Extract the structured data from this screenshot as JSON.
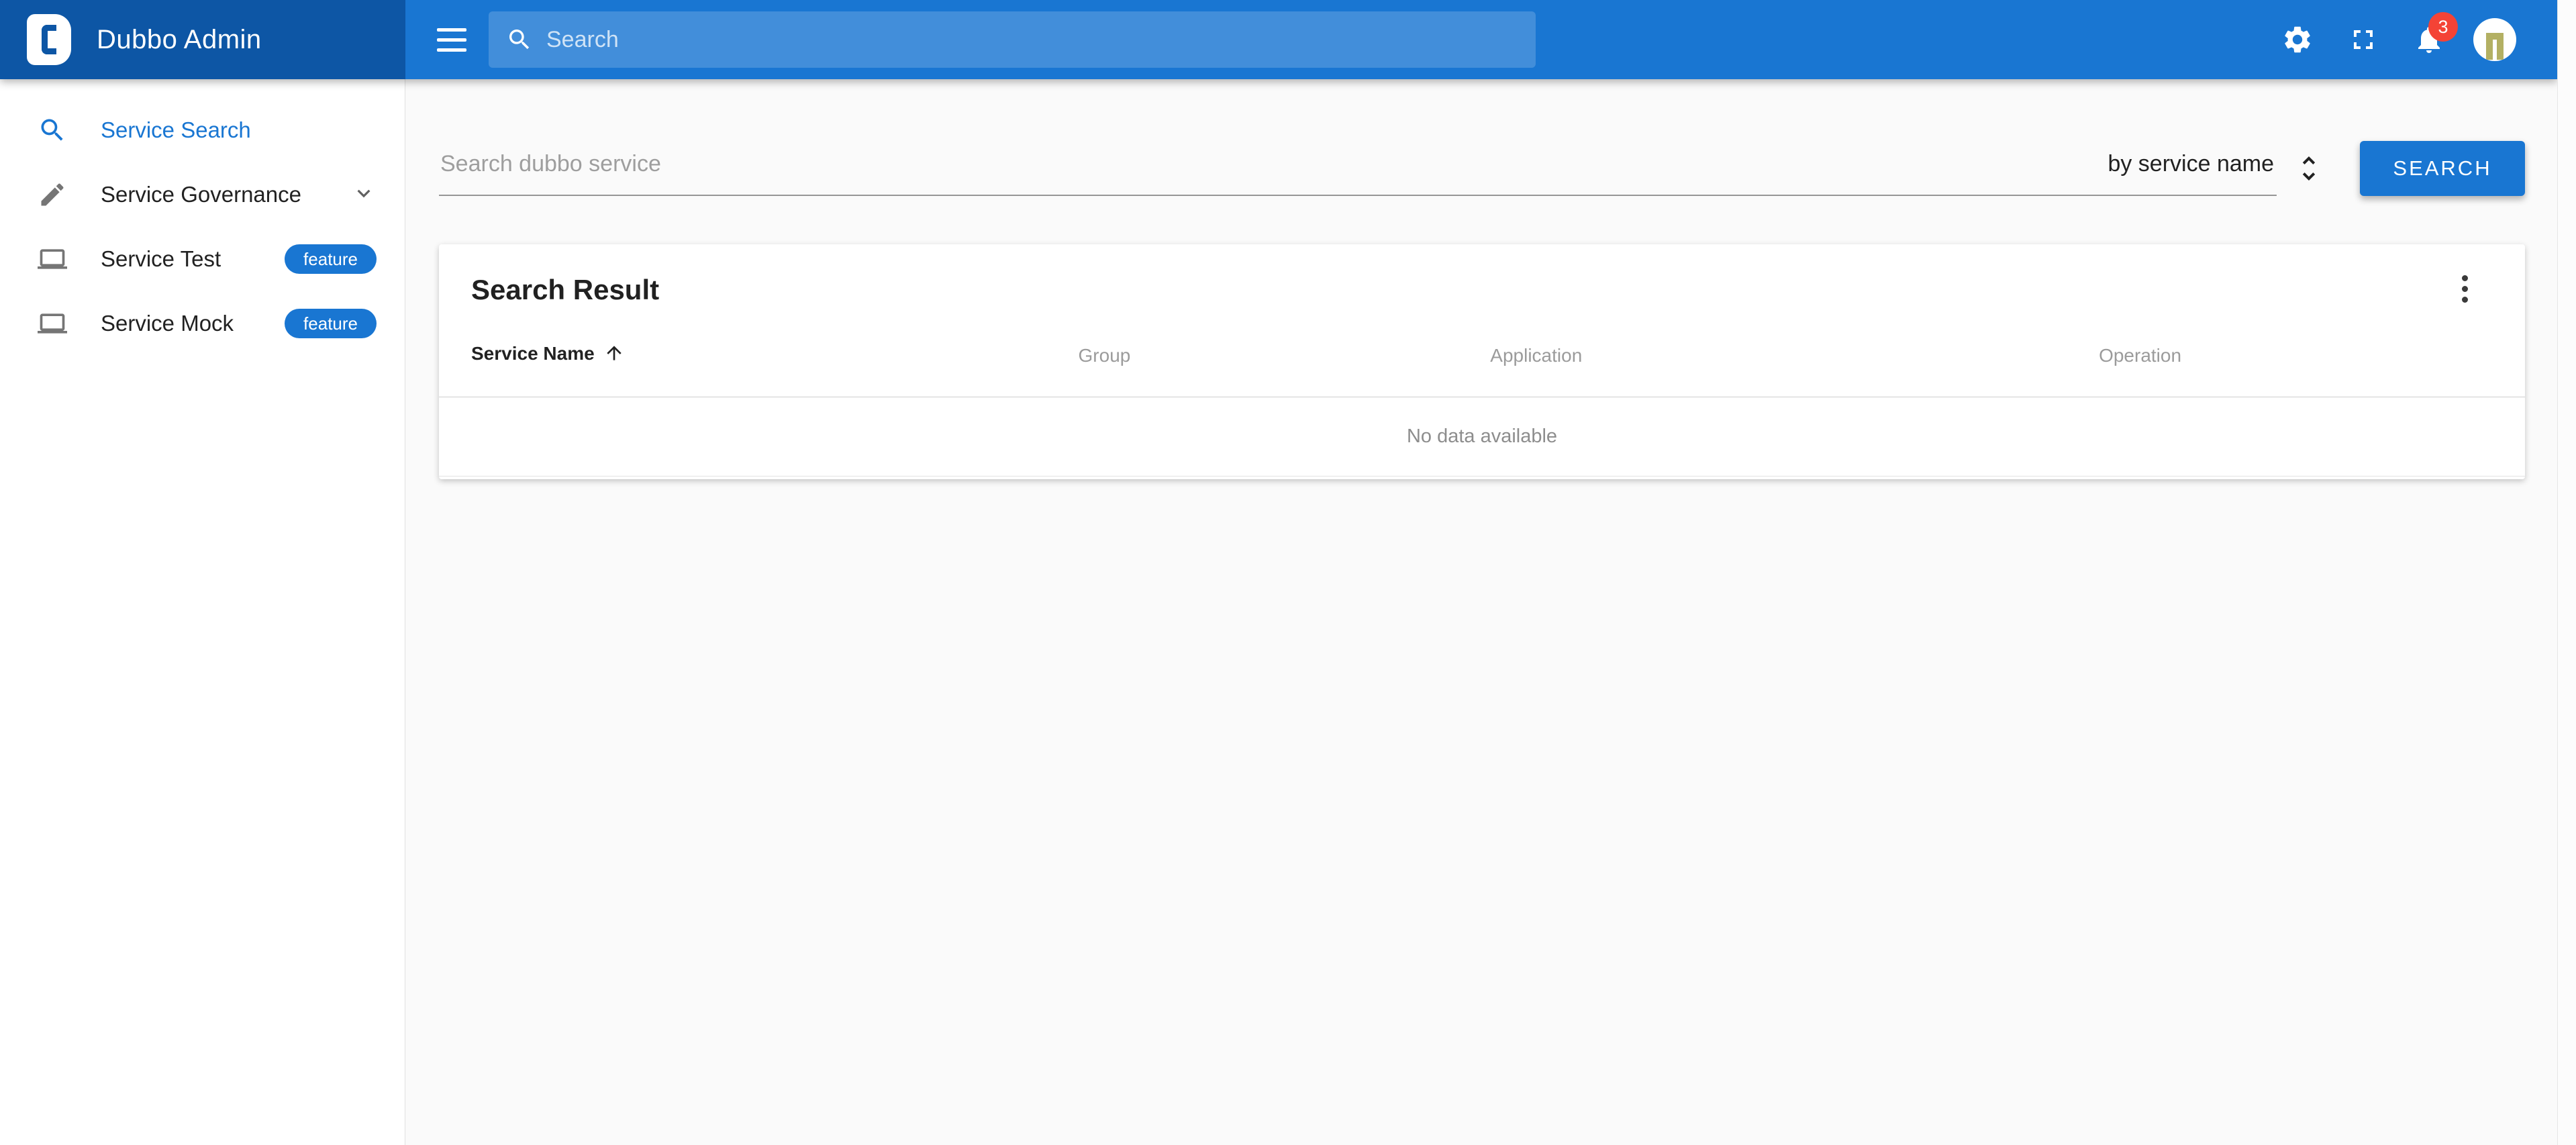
{
  "app_bar": {
    "title": "Dubbo Admin",
    "search": {
      "placeholder": "Search"
    },
    "notifications": {
      "badge_count": "3"
    }
  },
  "sidebar": {
    "items": [
      {
        "label": "Service Search"
      },
      {
        "label": "Service Governance"
      },
      {
        "label": "Service Test",
        "badge": "feature"
      },
      {
        "label": "Service Mock",
        "badge": "feature"
      }
    ]
  },
  "search_section": {
    "placeholder": "Search dubbo service",
    "sort_by": "by service name",
    "button": "SEARCH"
  },
  "result_card": {
    "title": "Search Result",
    "columns": {
      "service_name": "Service Name",
      "group": "Group",
      "application": "Application",
      "operation": "Operation"
    },
    "empty": "No data available"
  },
  "colors": {
    "primary": "#1976d2",
    "brand_dark": "#0d56a5",
    "badge_red": "#f44336",
    "avatar_glyph": "#b3b063"
  }
}
